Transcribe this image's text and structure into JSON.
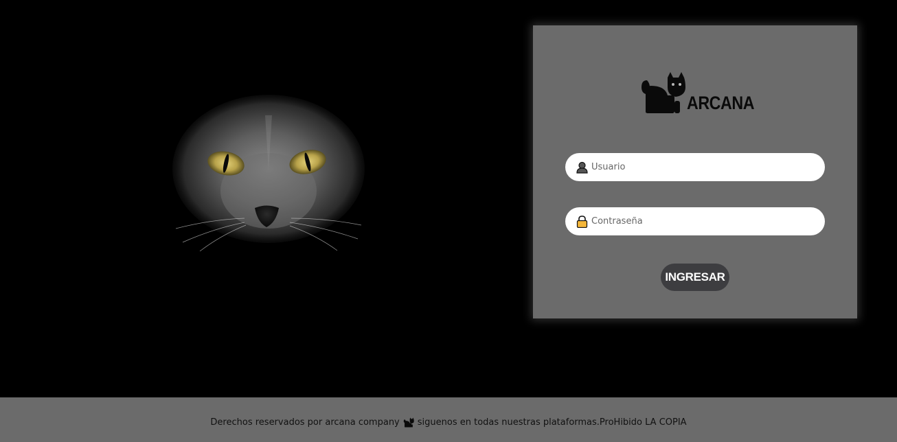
{
  "brand": {
    "name": "ARCANA",
    "icon": "black-cat-icon"
  },
  "hero": {
    "image": "black-cat-face-image",
    "eye_color": "#c7b45a"
  },
  "login": {
    "username_placeholder": "Usuario",
    "username_value": "",
    "username_icon": "user-icon",
    "password_placeholder": "Contraseña",
    "password_value": "",
    "password_icon": "lock-icon",
    "submit_label": "INGRESAR"
  },
  "footer": {
    "text_before": "Derechos reservados por arcana company",
    "icon": "black-cat-icon",
    "text_after": "siguenos en todas nuestras plataformas.ProHibido LA COPIA"
  },
  "colors": {
    "background": "#000000",
    "card": "#6b6b6b",
    "button": "#3d3d40",
    "footer": "#6b6b6b",
    "lock_icon": "#f5b73a"
  }
}
